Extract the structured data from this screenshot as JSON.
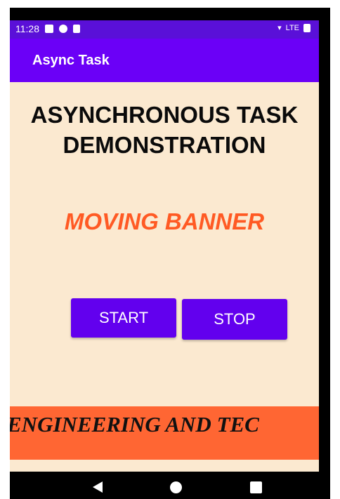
{
  "status_bar": {
    "time": "11:28",
    "network": "LTE",
    "icons": [
      "message-icon",
      "clock-icon",
      "sd-card-icon",
      "wifi-icon",
      "battery-icon"
    ]
  },
  "toolbar": {
    "title": "Async Task"
  },
  "main": {
    "heading": "ASYNCHRONOUS TASK DEMONSTRATION",
    "moving_label": "MOVING BANNER",
    "start_label": "START",
    "stop_label": "STOP",
    "banner_text": "ENGINEERING AND TEC"
  },
  "colors": {
    "status_bar": "#5a10d8",
    "toolbar": "#6b00f7",
    "background": "#fbe9d0",
    "accent_text": "#ff5a24",
    "button": "#6200ee",
    "banner": "#ff6633"
  },
  "navigation": {
    "icons": [
      "back-icon",
      "home-icon",
      "recent-apps-icon"
    ]
  }
}
